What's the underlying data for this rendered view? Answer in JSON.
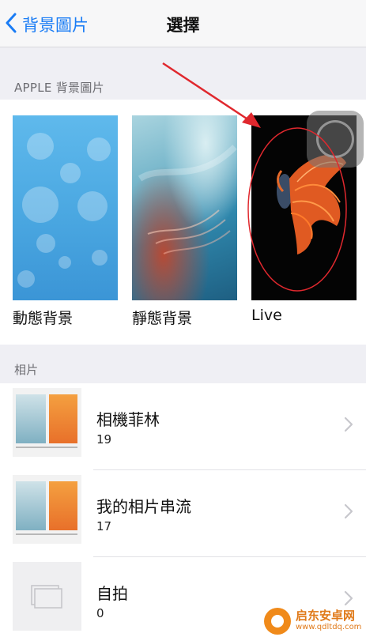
{
  "nav": {
    "back_label": "背景圖片",
    "title": "選擇"
  },
  "apple_section": {
    "header": "APPLE 背景圖片",
    "wallpapers": [
      {
        "label": "動態背景"
      },
      {
        "label": "靜態背景"
      },
      {
        "label": "Live"
      }
    ]
  },
  "photos_section": {
    "header": "相片",
    "albums": [
      {
        "title": "相機菲林",
        "count": "19"
      },
      {
        "title": "我的相片串流",
        "count": "17"
      },
      {
        "title": "自拍",
        "count": "0"
      }
    ]
  },
  "watermark": {
    "line1": "启东安卓网",
    "line2": "www.qdltdq.com"
  },
  "colors": {
    "accent": "#1a7cf5",
    "annotation": "#e0282e",
    "background": "#efeff4"
  },
  "icons": {
    "back": "chevron-left-icon",
    "row_chevron": "chevron-right-icon",
    "empty_album": "stacked-photos-icon"
  }
}
